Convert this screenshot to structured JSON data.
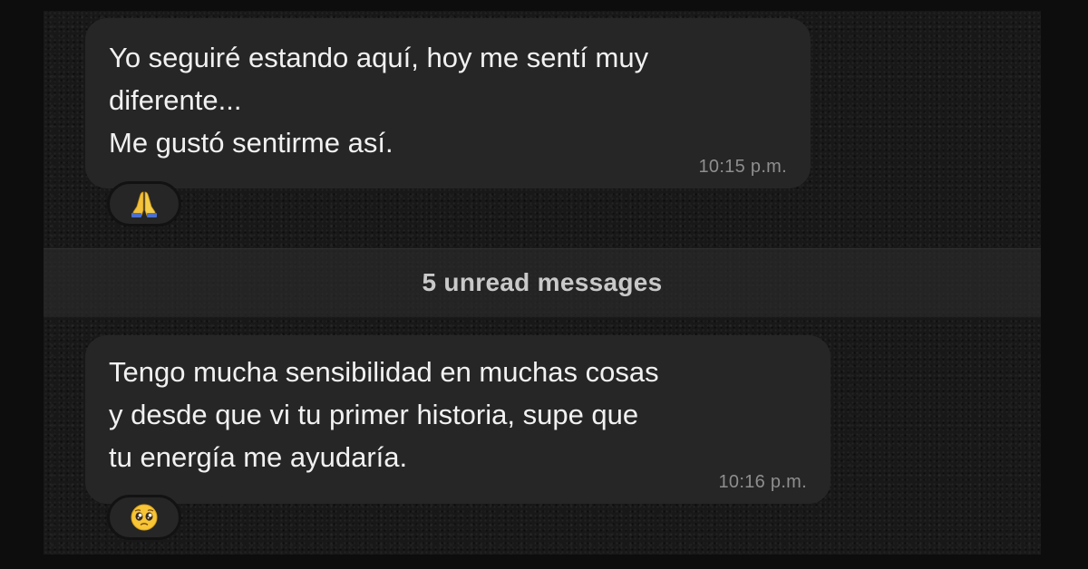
{
  "conversation": {
    "messages": [
      {
        "lines": [
          "Yo seguiré estando aquí, hoy me sentí muy",
          "diferente...",
          "Me gustó sentirme así."
        ],
        "time": "10:15 p.m.",
        "reaction": "folded-hands-emoji"
      },
      {
        "lines": [
          "Tengo mucha sensibilidad en muchas cosas",
          "y desde que vi tu primer historia, supe que",
          "tu energía me ayudaría."
        ],
        "time": "10:16 p.m.",
        "reaction": "pleading-face-emoji"
      }
    ],
    "unread_banner": "5 unread messages"
  },
  "colors": {
    "bubble": "#262626",
    "text": "#f1f1f1",
    "timestamp": "#8e8e8e",
    "background": "#181818",
    "banner_text": "#c9c9c9"
  }
}
